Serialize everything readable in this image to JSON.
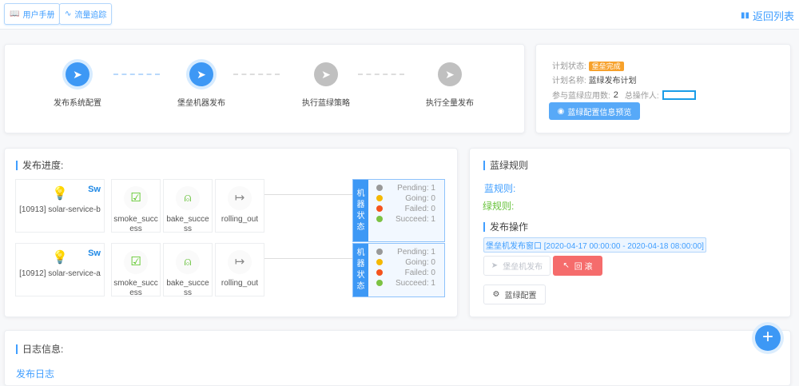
{
  "toolbar": {
    "manual": "用户手册",
    "trace": "流量追踪",
    "back": "返回列表"
  },
  "steps": [
    {
      "label": "发布系统配置",
      "active": true
    },
    {
      "label": "堡垒机器发布",
      "active": true
    },
    {
      "label": "执行蓝绿策略",
      "active": false
    },
    {
      "label": "执行全量发布",
      "active": false
    }
  ],
  "plan": {
    "status_label": "计划状态:",
    "status": "堡垒完成",
    "name_label": "计划名称:",
    "name": "蓝绿发布计划",
    "apps_label": "参与蓝绿应用数:",
    "apps": "2",
    "operator_label": "总操作人:",
    "operator": "",
    "preview_button": "蓝绿配置信息预览"
  },
  "progress": {
    "title": "发布进度:",
    "status_label": [
      "机",
      "器",
      "状",
      "态"
    ],
    "rows": [
      {
        "service": "[10913] solar-service-b",
        "badge": "Sw",
        "stages": [
          "smoke_success",
          "bake_success",
          "rolling_out"
        ],
        "counts": {
          "pending": "Pending: 1",
          "going": "Going: 0",
          "failed": "Failed: 0",
          "succeed": "Succeed: 1"
        }
      },
      {
        "service": "[10912] solar-service-a",
        "badge": "Sw",
        "stages": [
          "smoke_success",
          "bake_success",
          "rolling_out"
        ],
        "counts": {
          "pending": "Pending: 1",
          "going": "Going: 0",
          "failed": "Failed: 0",
          "succeed": "Succeed: 1"
        }
      }
    ]
  },
  "rules": {
    "title": "蓝绿规则",
    "blue": "蓝规则:",
    "green": "绿规则:",
    "ops_title": "发布操作",
    "window": "堡垒机发布窗口 [2020-04-17 00:00:00 - 2020-04-18 08:00:00]",
    "deploy_button": "堡垒机发布",
    "rollback_button": "回 滚",
    "config_button": "蓝绿配置"
  },
  "log": {
    "title": "日志信息:",
    "link": "发布日志"
  },
  "colors": {
    "primary": "#409eff",
    "pending": "#999999",
    "going": "#f5b800",
    "failed": "#f5531d",
    "succeed": "#7cc243",
    "danger": "#f56c6c"
  }
}
